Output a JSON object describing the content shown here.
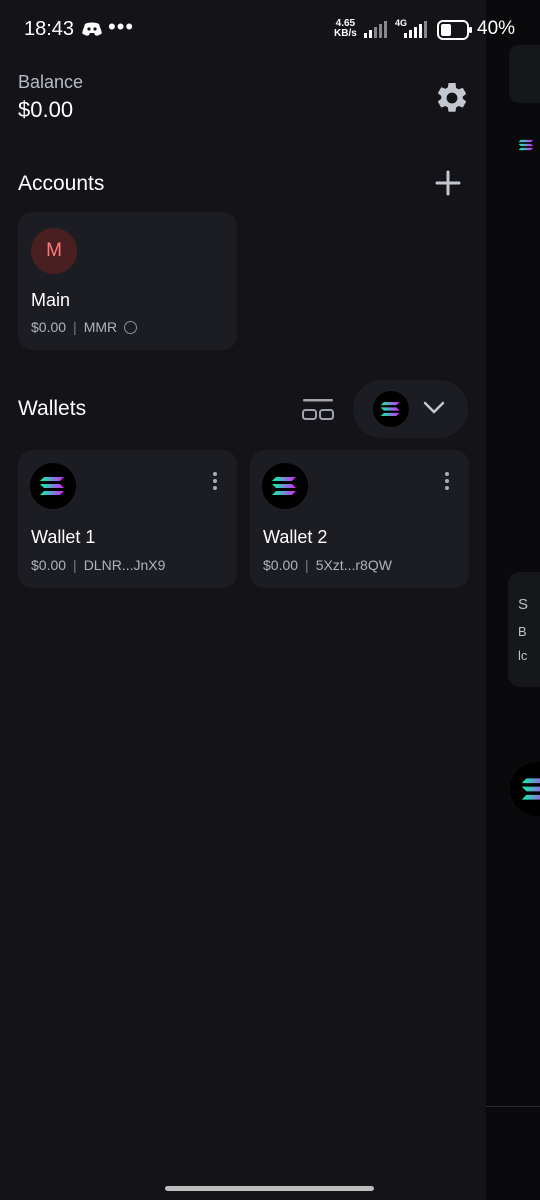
{
  "status_bar": {
    "time": "18:43",
    "more": "•••",
    "net_speed_value": "4.65",
    "net_speed_unit": "KB/s",
    "network": "4G",
    "battery": "40%"
  },
  "header": {
    "balance_label": "Balance",
    "balance_value": "$0.00"
  },
  "accounts": {
    "title": "Accounts",
    "items": [
      {
        "initial": "M",
        "name": "Main",
        "value": "$0.00",
        "separator": "|",
        "ticker": "MMR"
      }
    ]
  },
  "wallets": {
    "title": "Wallets",
    "chain_icon": "solana-icon",
    "items": [
      {
        "name": "Wallet 1",
        "value": "$0.00",
        "separator": "|",
        "address": "DLNR...JnX9"
      },
      {
        "name": "Wallet 2",
        "value": "$0.00",
        "separator": "|",
        "address": "5Xzt...r8QW"
      }
    ]
  },
  "colors": {
    "background": "#131318",
    "card": "#1c1d22",
    "avatar_bg": "#4a1f22",
    "avatar_text": "#ff7a7a"
  }
}
